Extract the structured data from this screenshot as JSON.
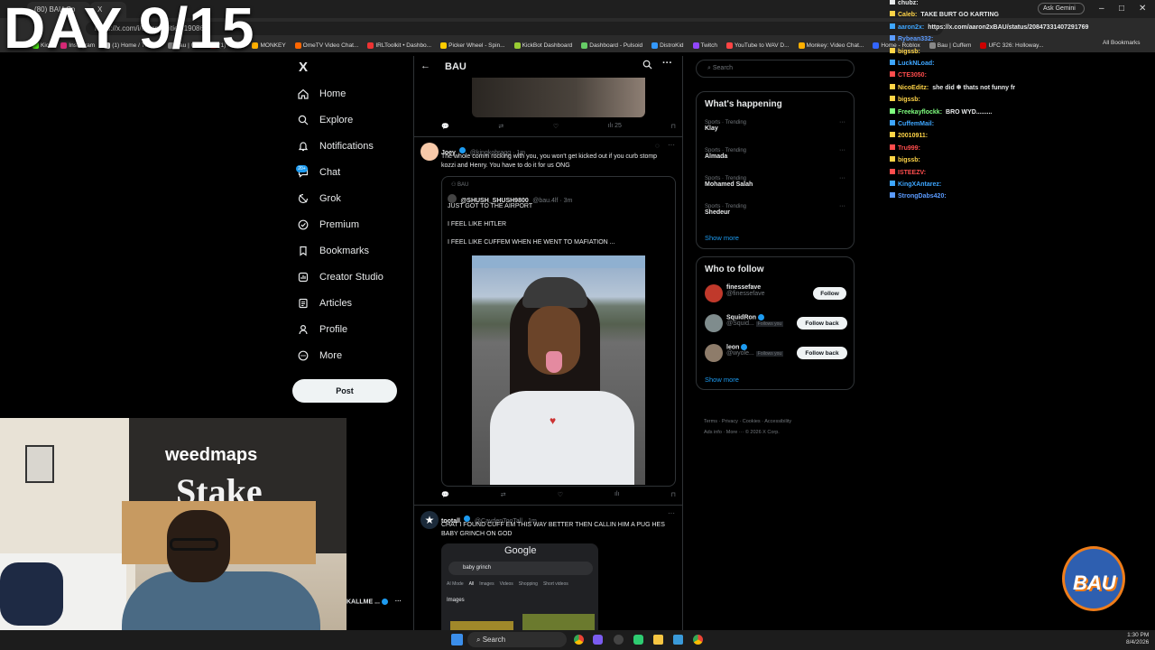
{
  "overlay": {
    "day_label": "DAY 9/15"
  },
  "browser": {
    "tabs": [
      "(80) BAU Co",
      "X"
    ],
    "url": "https://x.com/i/communities/19086",
    "bookmarks": [
      "Kick",
      "Instagram",
      "(1) Home / Twitter",
      "Bau | Cuff",
      "(1) Home",
      "MONKEY",
      "OmeTV Video Chat...",
      "IRLToolkit • Dashbo...",
      "Picker Wheel - Spin...",
      "KickBot Dashboard",
      "Dashboard - Pulsoid",
      "DistroKid",
      "Twitch",
      "YouTube to WAV D...",
      "Monkey: Video Chat...",
      "Home - Roblox",
      "Bau | Cuffem",
      "UFC 326: Holloway...",
      "All Bookmarks"
    ],
    "ask_gemini": "Ask Gemini"
  },
  "nav": {
    "logo": "X",
    "items": [
      "Home",
      "Explore",
      "Notifications",
      "Chat",
      "Grok",
      "Premium",
      "Bookmarks",
      "Creator Studio",
      "Articles",
      "Profile",
      "More"
    ],
    "chat_badge": "20+",
    "post_label": "Post",
    "account_name": "KALLME ..."
  },
  "header": {
    "title": "BAU"
  },
  "top_post_actions": {
    "views": "25"
  },
  "posts": [
    {
      "name": "Joey",
      "handle": "@kingkobragg · 1m",
      "text": "The whole comm rocking with you, you won't get kicked out if you curb stomp kozzi and Henry. You have to do it for us ONG",
      "quote": {
        "community": "BAU",
        "name": "@SHUSH_SHUSH9800",
        "handle": "@bau.4lf · 3m",
        "lines": [
          "JUST GOT TO THE AIRPORT",
          "I FEEL LIKE HITLER",
          "I FEEL LIKE CUFFEM WHEN HE WENT TO MAFIATION ..."
        ]
      }
    },
    {
      "name": "tootall",
      "handle": "@CaydenTooTall · 1m",
      "text": "CHAT I FOUND CUFF EM THIS WAY BETTER THEN CALLIN HIM A PUG HES BABY GRINCH ON GOD",
      "embed": {
        "brand": "Google",
        "query": "baby grinch",
        "tabs": [
          "AI Mode",
          "All",
          "Images",
          "Videos",
          "Shopping",
          "Short videos"
        ],
        "section": "Images"
      }
    }
  ],
  "right": {
    "search_placeholder": "Search",
    "happening_title": "What's happening",
    "trends": [
      {
        "category": "Sports · Trending",
        "name": "Klay"
      },
      {
        "category": "Sports · Trending",
        "name": "Almada"
      },
      {
        "category": "Sports · Trending",
        "name": "Mohamed Salah"
      },
      {
        "category": "Sports · Trending",
        "name": "Shedeur"
      }
    ],
    "show_more": "Show more",
    "follow_title": "Who to follow",
    "follow": [
      {
        "name": "finessefave",
        "handle": "@finessefave",
        "button": "Follow",
        "follows_you": ""
      },
      {
        "name": "SquidRon",
        "handle": "@Squid...",
        "button": "Follow back",
        "follows_you": "Follows you"
      },
      {
        "name": "leon",
        "handle": "@wyole...",
        "button": "Follow back",
        "follows_you": "Follows you"
      }
    ],
    "footer_line1": "Terms · Privacy · Cookies · Accessibility",
    "footer_line2": "Ads info · More ··· © 2026 X Corp."
  },
  "chat": [
    {
      "user": "chubz:",
      "msg": "",
      "color": "#e7e9ea"
    },
    {
      "user": "Caleb:",
      "msg": "TAKE BURT GO KARTING",
      "color": "#ffd447"
    },
    {
      "user": "aaron2x:",
      "msg": "https://x.com/aaron2xBAU/status/20847331407291769",
      "color": "#3ea6ff"
    },
    {
      "user": "Rybean332:",
      "msg": "",
      "color": "#5b9bff"
    },
    {
      "user": "bigssb:",
      "msg": "",
      "color": "#ffd447"
    },
    {
      "user": "LuckNLoad:",
      "msg": "",
      "color": "#3ea6ff"
    },
    {
      "user": "CTE3050:",
      "msg": "",
      "color": "#ff4d4d"
    },
    {
      "user": "NicoEditz:",
      "msg": "she did ❄ thats not funny fr",
      "color": "#ffd447"
    },
    {
      "user": "bigssb:",
      "msg": "",
      "color": "#ffd447"
    },
    {
      "user": "Freekayflockk:",
      "msg": "BRO WYD.........",
      "color": "#7fff7f"
    },
    {
      "user": "CuffemMail:",
      "msg": "",
      "color": "#3ea6ff"
    },
    {
      "user": "20010911:",
      "msg": "",
      "color": "#ffd447"
    },
    {
      "user": "Tru999:",
      "msg": "",
      "color": "#ff4d4d"
    },
    {
      "user": "bigssb:",
      "msg": "",
      "color": "#ffd447"
    },
    {
      "user": "ISTEEZV:",
      "msg": "",
      "color": "#ff4d4d"
    },
    {
      "user": "KingXAntarez:",
      "msg": "",
      "color": "#3ea6ff"
    },
    {
      "user": "StrongDabs420:",
      "msg": "",
      "color": "#5b9bff"
    }
  ],
  "stream": {
    "wall_logo": "weedmaps",
    "banner": "Stake",
    "team_badge": "BAU"
  },
  "taskbar": {
    "search": "Search",
    "time": "1:30 PM",
    "date": "8/4/2026"
  }
}
